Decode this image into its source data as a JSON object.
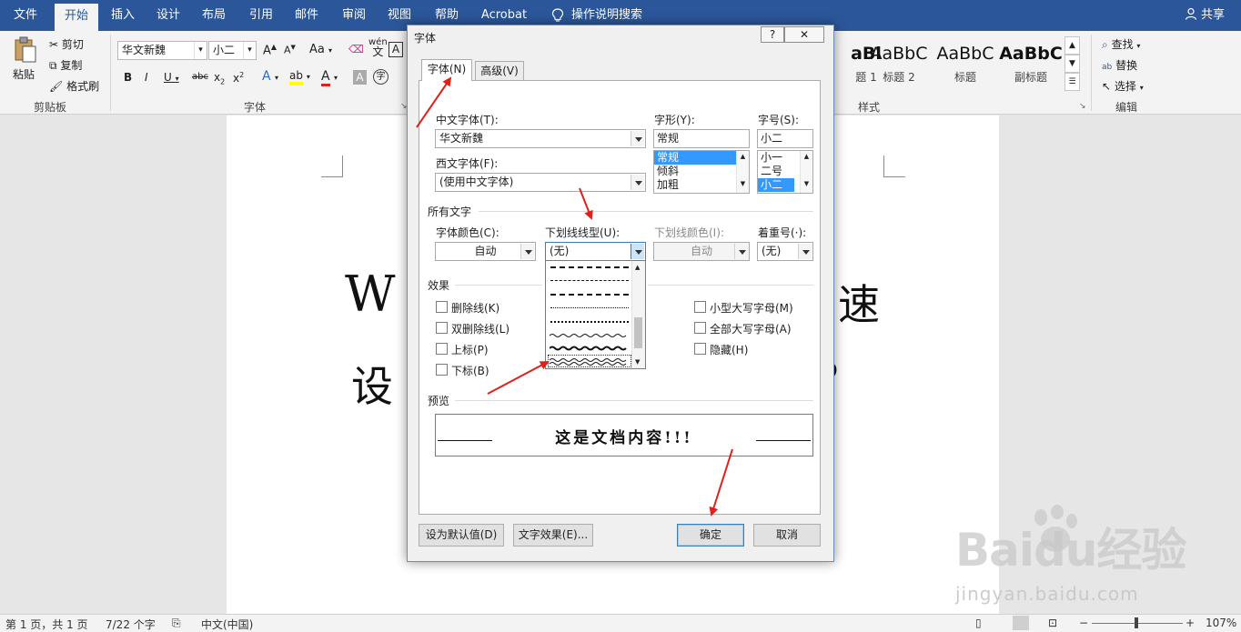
{
  "menubar": {
    "tabs": [
      "文件",
      "开始",
      "插入",
      "设计",
      "布局",
      "引用",
      "邮件",
      "审阅",
      "视图",
      "帮助",
      "Acrobat"
    ],
    "active_tab": "开始",
    "search": "操作说明搜索",
    "share": "共享"
  },
  "ribbon": {
    "clipboard": {
      "paste": "粘贴",
      "cut": "剪切",
      "copy": "复制",
      "format_painter": "格式刷",
      "group_label": "剪贴板"
    },
    "font": {
      "font_name": "华文新魏",
      "font_size": "小二",
      "group_label": "字体",
      "aa_label": "Aa",
      "wen_label": "wén",
      "wen_char": "文",
      "a_box": "A"
    },
    "styles": {
      "tiles": [
        {
          "sample": "aBl",
          "name": "题 1"
        },
        {
          "sample": "AaBbC",
          "name": "标题 2"
        },
        {
          "sample": "AaBbC",
          "name": "标题"
        },
        {
          "sample": "AaBbC",
          "name": "副标题"
        }
      ],
      "group_label": "样式"
    },
    "editing": {
      "find": "查找",
      "replace": "替换",
      "select": "选择",
      "group_label": "编辑"
    }
  },
  "document": {
    "line1_start": "W",
    "line1_end": "速",
    "line2_start": "设",
    "line2_end": "?"
  },
  "status": {
    "page": "第 1 页，共 1 页",
    "words": "7/22 个字",
    "lang": "中文(中国)",
    "zoom": "107%"
  },
  "watermark": {
    "logo": "Baidu经验",
    "url": "jingyan.baidu.com"
  },
  "dialog": {
    "title": "字体",
    "help": "?",
    "tabs": [
      "字体(N)",
      "高级(V)"
    ],
    "labels": {
      "cn_font": "中文字体(T):",
      "west_font": "西文字体(F):",
      "style": "字形(Y):",
      "size": "字号(S):",
      "all_text": "所有文字",
      "font_color": "字体颜色(C):",
      "underline_type": "下划线线型(U):",
      "underline_color": "下划线颜色(I):",
      "emphasis": "着重号(·):",
      "effects": "效果",
      "preview": "预览"
    },
    "values": {
      "cn_font": "华文新魏",
      "west_font": "(使用中文字体)",
      "style": "常规",
      "size": "小二",
      "font_color": "自动",
      "underline_type": "(无)",
      "underline_color": "自动",
      "emphasis": "(无)"
    },
    "style_list": [
      "常规",
      "倾斜",
      "加粗"
    ],
    "style_selected": 0,
    "size_list": [
      "小一",
      "二号",
      "小二"
    ],
    "size_selected": 2,
    "effects_left": [
      "删除线(K)",
      "双删除线(L)",
      "上标(P)",
      "下标(B)"
    ],
    "effects_right": [
      "小型大写字母(M)",
      "全部大写字母(A)",
      "隐藏(H)"
    ],
    "preview_text": "这是文档内容!!!",
    "buttons": {
      "set_default": "设为默认值(D)",
      "text_effects": "文字效果(E)...",
      "ok": "确定",
      "cancel": "取消"
    }
  },
  "colors": {
    "title_bar": "#2b579a",
    "annotation_arrow": "#e0201b",
    "selection": "#3399ff"
  }
}
